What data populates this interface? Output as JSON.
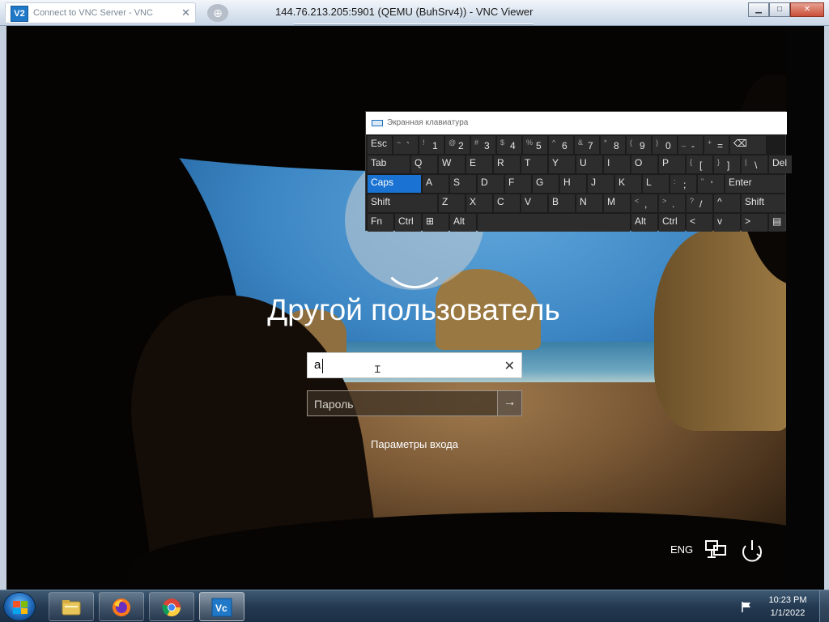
{
  "window": {
    "title": "144.76.213.205:5901 (QEMU (BuhSrv4)) - VNC Viewer",
    "tab_label": "Connect to VNC Server - VNC",
    "tab_icon_text": "V2",
    "buttons": [
      "minimize",
      "maximize",
      "close"
    ]
  },
  "login": {
    "user_name": "Другой пользователь",
    "username_value": "a",
    "password_placeholder": "Пароль",
    "signin_options": "Параметры входа"
  },
  "status": {
    "language": "ENG"
  },
  "osk": {
    "title": "Экранная клавиатура",
    "rows": [
      [
        {
          "main": "Esc",
          "w": 30
        },
        {
          "sub": "~",
          "main": "`",
          "w": 30
        },
        {
          "sub": "!",
          "main": "1",
          "w": 30
        },
        {
          "sub": "@",
          "main": "2",
          "w": 30
        },
        {
          "sub": "#",
          "main": "3",
          "w": 30
        },
        {
          "sub": "$",
          "main": "4",
          "w": 30
        },
        {
          "sub": "%",
          "main": "5",
          "w": 30
        },
        {
          "sub": "^",
          "main": "6",
          "w": 30
        },
        {
          "sub": "&",
          "main": "7",
          "w": 30
        },
        {
          "sub": "*",
          "main": "8",
          "w": 30
        },
        {
          "sub": "(",
          "main": "9",
          "w": 30
        },
        {
          "sub": ")",
          "main": "0",
          "w": 30
        },
        {
          "sub": "_",
          "main": "-",
          "w": 30
        },
        {
          "sub": "+",
          "main": "=",
          "w": 30
        },
        {
          "main": "⌫",
          "w": 44
        }
      ],
      [
        {
          "main": "Tab",
          "w": 52
        },
        {
          "main": "Q",
          "w": 32
        },
        {
          "main": "W",
          "w": 32
        },
        {
          "main": "E",
          "w": 32
        },
        {
          "main": "R",
          "w": 32
        },
        {
          "main": "T",
          "w": 32
        },
        {
          "main": "Y",
          "w": 32
        },
        {
          "main": "U",
          "w": 32
        },
        {
          "main": "I",
          "w": 32
        },
        {
          "main": "O",
          "w": 32
        },
        {
          "main": "P",
          "w": 32
        },
        {
          "sub": "{",
          "main": "[",
          "w": 32
        },
        {
          "sub": "}",
          "main": "]",
          "w": 32
        },
        {
          "sub": "|",
          "main": "\\",
          "w": 32
        },
        {
          "main": "Del",
          "w": 28
        }
      ],
      [
        {
          "main": "Caps",
          "w": 66,
          "active": true
        },
        {
          "main": "A",
          "w": 32
        },
        {
          "main": "S",
          "w": 32
        },
        {
          "main": "D",
          "w": 32
        },
        {
          "main": "F",
          "w": 32
        },
        {
          "main": "G",
          "w": 32
        },
        {
          "main": "H",
          "w": 32
        },
        {
          "main": "J",
          "w": 32
        },
        {
          "main": "K",
          "w": 32
        },
        {
          "main": "L",
          "w": 32
        },
        {
          "sub": ":",
          "main": ";",
          "w": 32
        },
        {
          "sub": "\"",
          "main": "'",
          "w": 32
        },
        {
          "main": "Enter",
          "w": 74
        }
      ],
      [
        {
          "main": "Shift",
          "w": 86
        },
        {
          "main": "Z",
          "w": 32
        },
        {
          "main": "X",
          "w": 32
        },
        {
          "main": "C",
          "w": 32
        },
        {
          "main": "V",
          "w": 32
        },
        {
          "main": "B",
          "w": 32
        },
        {
          "main": "N",
          "w": 32
        },
        {
          "main": "M",
          "w": 32
        },
        {
          "sub": "<",
          "main": ",",
          "w": 32
        },
        {
          "sub": ">",
          "main": ".",
          "w": 32
        },
        {
          "sub": "?",
          "main": "/",
          "w": 32
        },
        {
          "main": "^",
          "w": 32
        },
        {
          "main": "Shift",
          "w": 54
        }
      ],
      [
        {
          "main": "Fn",
          "w": 32
        },
        {
          "main": "Ctrl",
          "w": 32
        },
        {
          "main": "⊞",
          "w": 32
        },
        {
          "main": "Alt",
          "w": 32
        },
        {
          "main": "",
          "w": 188
        },
        {
          "main": "Alt",
          "w": 32
        },
        {
          "main": "Ctrl",
          "w": 32
        },
        {
          "main": "<",
          "w": 32
        },
        {
          "main": "v",
          "w": 32
        },
        {
          "main": ">",
          "w": 32
        },
        {
          "main": "▤",
          "w": 20
        }
      ]
    ]
  },
  "taskbar": {
    "apps": [
      "windows-explorer",
      "firefox",
      "chrome",
      "vnc-viewer"
    ],
    "time": "10:23 PM",
    "date": "1/1/2022"
  },
  "colors": {
    "caps_active": "#1a73d2",
    "osk_bg": "#1c1c1c",
    "taskbar": "#243a52"
  }
}
